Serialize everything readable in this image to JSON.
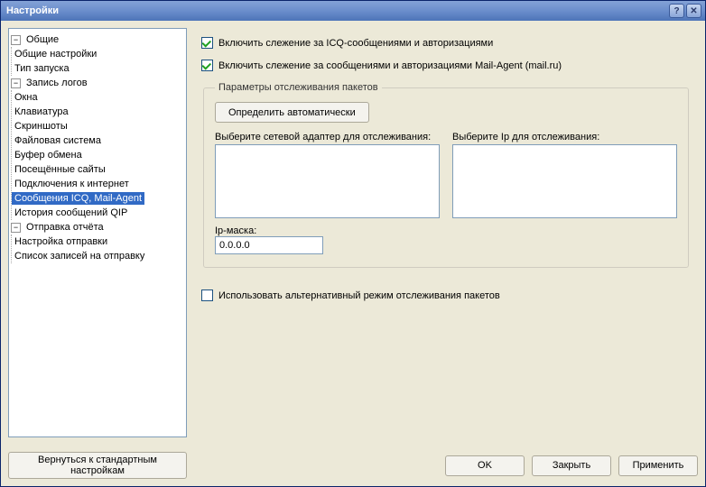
{
  "window": {
    "title": "Настройки"
  },
  "tree": {
    "general": {
      "label": "Общие"
    },
    "general_settings": {
      "label": "Общие настройки"
    },
    "startup_type": {
      "label": "Тип запуска"
    },
    "logs": {
      "label": "Запись логов"
    },
    "windows": {
      "label": "Окна"
    },
    "keyboard": {
      "label": "Клавиатура"
    },
    "screenshots": {
      "label": "Скриншоты"
    },
    "filesystem": {
      "label": "Файловая система"
    },
    "clipboard": {
      "label": "Буфер обмена"
    },
    "visited_sites": {
      "label": "Посещённые сайты"
    },
    "internet_conn": {
      "label": "Подключения к интернет"
    },
    "icq_mailagent": {
      "label": "Сообщения ICQ, Mail-Agent"
    },
    "qip_history": {
      "label": "История сообщений QIP"
    },
    "report": {
      "label": "Отправка отчёта"
    },
    "send_settings": {
      "label": "Настройка отправки"
    },
    "send_list": {
      "label": "Список записей на отправку"
    }
  },
  "checks": {
    "icq": "Включить слежение за ICQ-сообщениями и авторизациями",
    "mailagent": "Включить слежение за сообщениями и авторизациями Mail-Agent (mail.ru)",
    "alt_mode": "Использовать альтернативный режим отслеживания пакетов"
  },
  "group": {
    "legend": "Параметры отслеживания пакетов",
    "auto_detect": "Определить автоматически",
    "adapter_label": "Выберите сетевой адаптер для отслеживания:",
    "ip_label": "Выберите Ip для отслеживания:",
    "ipmask_label": "Ip-маска:",
    "ipmask_value": "0.0.0.0"
  },
  "buttons": {
    "reset": "Вернуться к стандартным настройкам",
    "ok": "OK",
    "close": "Закрыть",
    "apply": "Применить"
  }
}
